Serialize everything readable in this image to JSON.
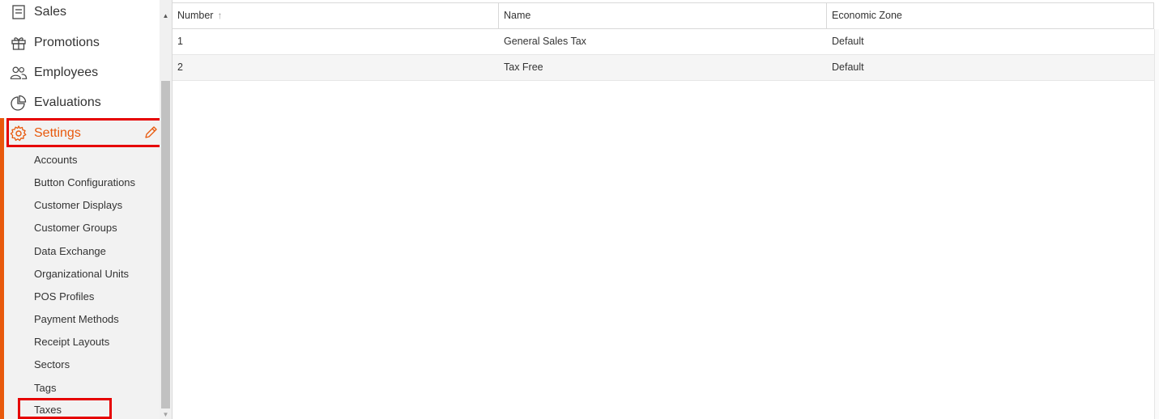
{
  "sidebar": {
    "items": [
      {
        "label": "Sales",
        "icon": "receipt-icon"
      },
      {
        "label": "Promotions",
        "icon": "gift-icon"
      },
      {
        "label": "Employees",
        "icon": "users-icon"
      },
      {
        "label": "Evaluations",
        "icon": "pie-chart-icon"
      },
      {
        "label": "Settings",
        "icon": "gear-icon"
      }
    ],
    "settings_sub_items": [
      "Accounts",
      "Button Configurations",
      "Customer Displays",
      "Customer Groups",
      "Data Exchange",
      "Organizational Units",
      "POS Profiles",
      "Payment Methods",
      "Receipt Layouts",
      "Sectors",
      "Tags",
      "Taxes"
    ],
    "active_item": "Settings",
    "active_sub_item": "Taxes"
  },
  "table": {
    "columns": [
      "Number",
      "Name",
      "Economic Zone"
    ],
    "sort_column": "Number",
    "sort_direction": "ascending",
    "rows": [
      {
        "number": "1",
        "name": "General Sales Tax",
        "economic_zone": "Default"
      },
      {
        "number": "2",
        "name": "Tax Free",
        "economic_zone": "Default"
      }
    ]
  },
  "colors": {
    "accent": "#e8590c",
    "highlight_box": "#e60000"
  }
}
